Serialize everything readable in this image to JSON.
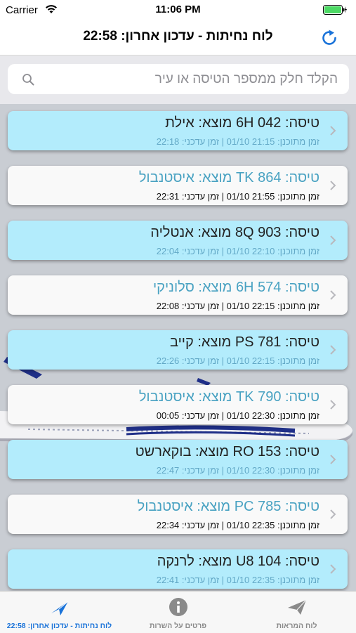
{
  "status_bar": {
    "carrier": "Carrier",
    "time": "11:06 PM"
  },
  "nav": {
    "title": "לוח נחיתות - עדכון אחרון: 22:58"
  },
  "search": {
    "placeholder": "הקלד חלק ממספר הטיסה או עיר"
  },
  "background_image": {
    "airline_logo": "ELAL"
  },
  "flights": [
    {
      "title": "טיסה: 6H 042 מוצא: אילת",
      "subtitle": "זמן מתוכנן: 21:15 01/10 | זמן עדכני: 22:18",
      "style": "cyan"
    },
    {
      "title": "טיסה: TK 864 מוצא: איסטנבול",
      "subtitle": "זמן מתוכנן: 21:55 01/10 | זמן עדכני: 22:31",
      "style": "white"
    },
    {
      "title": "טיסה: 8Q 903 מוצא: אנטליה",
      "subtitle": "זמן מתוכנן: 22:10 01/10 | זמן עדכני: 22:04",
      "style": "cyan"
    },
    {
      "title": "טיסה: 6H 574 מוצא: סלוניקי",
      "subtitle": "זמן מתוכנן: 22:15 01/10 | זמן עדכני: 22:08",
      "style": "white"
    },
    {
      "title": "טיסה: PS 781 מוצא: קייב",
      "subtitle": "זמן מתוכנן: 22:15 01/10 | זמן עדכני: 22:26",
      "style": "cyan"
    },
    {
      "title": "טיסה: TK 790 מוצא: איסטנבול",
      "subtitle": "זמן מתוכנן: 22:30 01/10 | זמן עדכני: 00:05",
      "style": "white"
    },
    {
      "title": "טיסה: RO 153 מוצא: בוקארשט",
      "subtitle": "זמן מתוכנן: 22:30 01/10 | זמן עדכני: 22:47",
      "style": "cyan"
    },
    {
      "title": "טיסה: PC 785 מוצא: איסטנבול",
      "subtitle": "זמן מתוכנן: 22:35 01/10 | זמן עדכני: 22:34",
      "style": "white"
    },
    {
      "title": "טיסה: U8 104 מוצא: לרנקה",
      "subtitle": "זמן מתוכנן: 22:35 01/10 | זמן עדכני: 22:41",
      "style": "cyan"
    }
  ],
  "tabs": [
    {
      "label": "לוח נחיתות - עדכון אחרון: 22:58",
      "icon": "landing-plane-icon",
      "active": true
    },
    {
      "label": "פרטים על השרות",
      "icon": "info-icon",
      "active": false
    },
    {
      "label": "לוח המראות",
      "icon": "takeoff-plane-icon",
      "active": false
    }
  ],
  "colors": {
    "accent": "#1a73d9",
    "row_cyan": "#b3ecfc",
    "row_white": "#f9f9f9",
    "list_bg": "#c9cdd3",
    "inactive_tab": "#8a8a8a"
  }
}
